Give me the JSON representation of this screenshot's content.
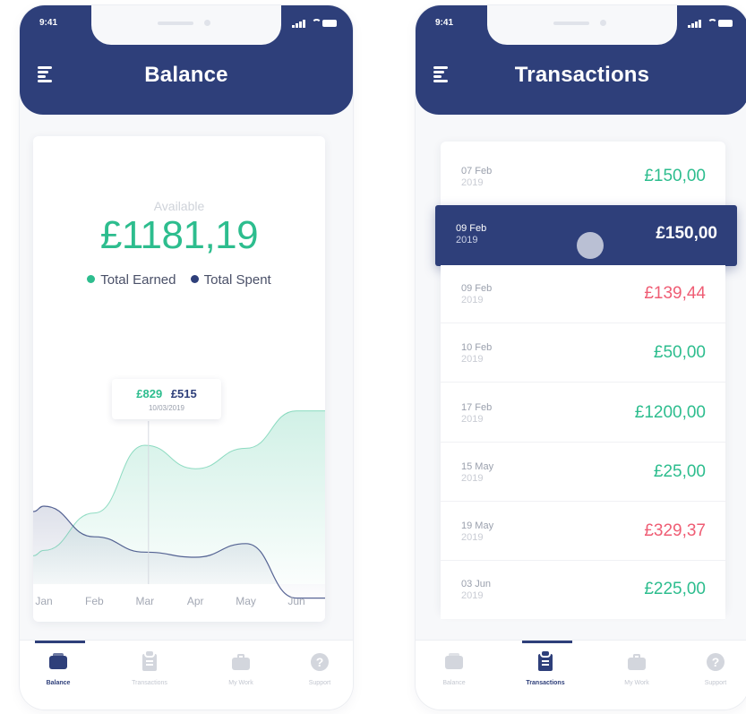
{
  "colors": {
    "primary": "#2e3f7a",
    "earned": "#2dbd8e",
    "spent": "#ef5d74"
  },
  "status_bar": {
    "time": "9:41"
  },
  "balance_screen": {
    "title": "Balance",
    "available_label": "Available",
    "amount": "£1181,19",
    "legend": {
      "earned": "Total Earned",
      "spent": "Total Spent"
    },
    "tooltip": {
      "earned": "£829",
      "spent": "£515",
      "date": "10/03/2019"
    },
    "chart_data": {
      "type": "area",
      "categories": [
        "Jan",
        "Feb",
        "Mar",
        "Apr",
        "May",
        "Jun"
      ],
      "series": [
        {
          "name": "Total Earned",
          "values": [
            520,
            630,
            829,
            760,
            820,
            930
          ]
        },
        {
          "name": "Total Spent",
          "values": [
            650,
            560,
            515,
            500,
            540,
            380
          ]
        }
      ],
      "highlighted_category": "Mar",
      "xlabel": "",
      "ylabel": ""
    }
  },
  "transactions_screen": {
    "title": "Transactions",
    "items": [
      {
        "date": "07 Feb",
        "year": "2019",
        "amount": "£150,00",
        "type": "positive"
      },
      {
        "date": "09 Feb",
        "year": "2019",
        "amount": "£150,00",
        "type": "positive",
        "selected": true
      },
      {
        "date": "09 Feb",
        "year": "2019",
        "amount": "£139,44",
        "type": "negative"
      },
      {
        "date": "10 Feb",
        "year": "2019",
        "amount": "£50,00",
        "type": "positive"
      },
      {
        "date": "17 Feb",
        "year": "2019",
        "amount": "£1200,00",
        "type": "positive"
      },
      {
        "date": "15 May",
        "year": "2019",
        "amount": "£25,00",
        "type": "positive"
      },
      {
        "date": "19 May",
        "year": "2019",
        "amount": "£329,37",
        "type": "negative"
      },
      {
        "date": "03 Jun",
        "year": "2019",
        "amount": "£225,00",
        "type": "positive"
      }
    ]
  },
  "bottom_nav": {
    "items": [
      {
        "label": "Balance",
        "icon": "wallet-icon"
      },
      {
        "label": "Transactions",
        "icon": "clipboard-icon"
      },
      {
        "label": "My Work",
        "icon": "briefcase-icon"
      },
      {
        "label": "Support",
        "icon": "help-icon"
      }
    ],
    "left_active": "Balance",
    "right_active": "Transactions"
  }
}
